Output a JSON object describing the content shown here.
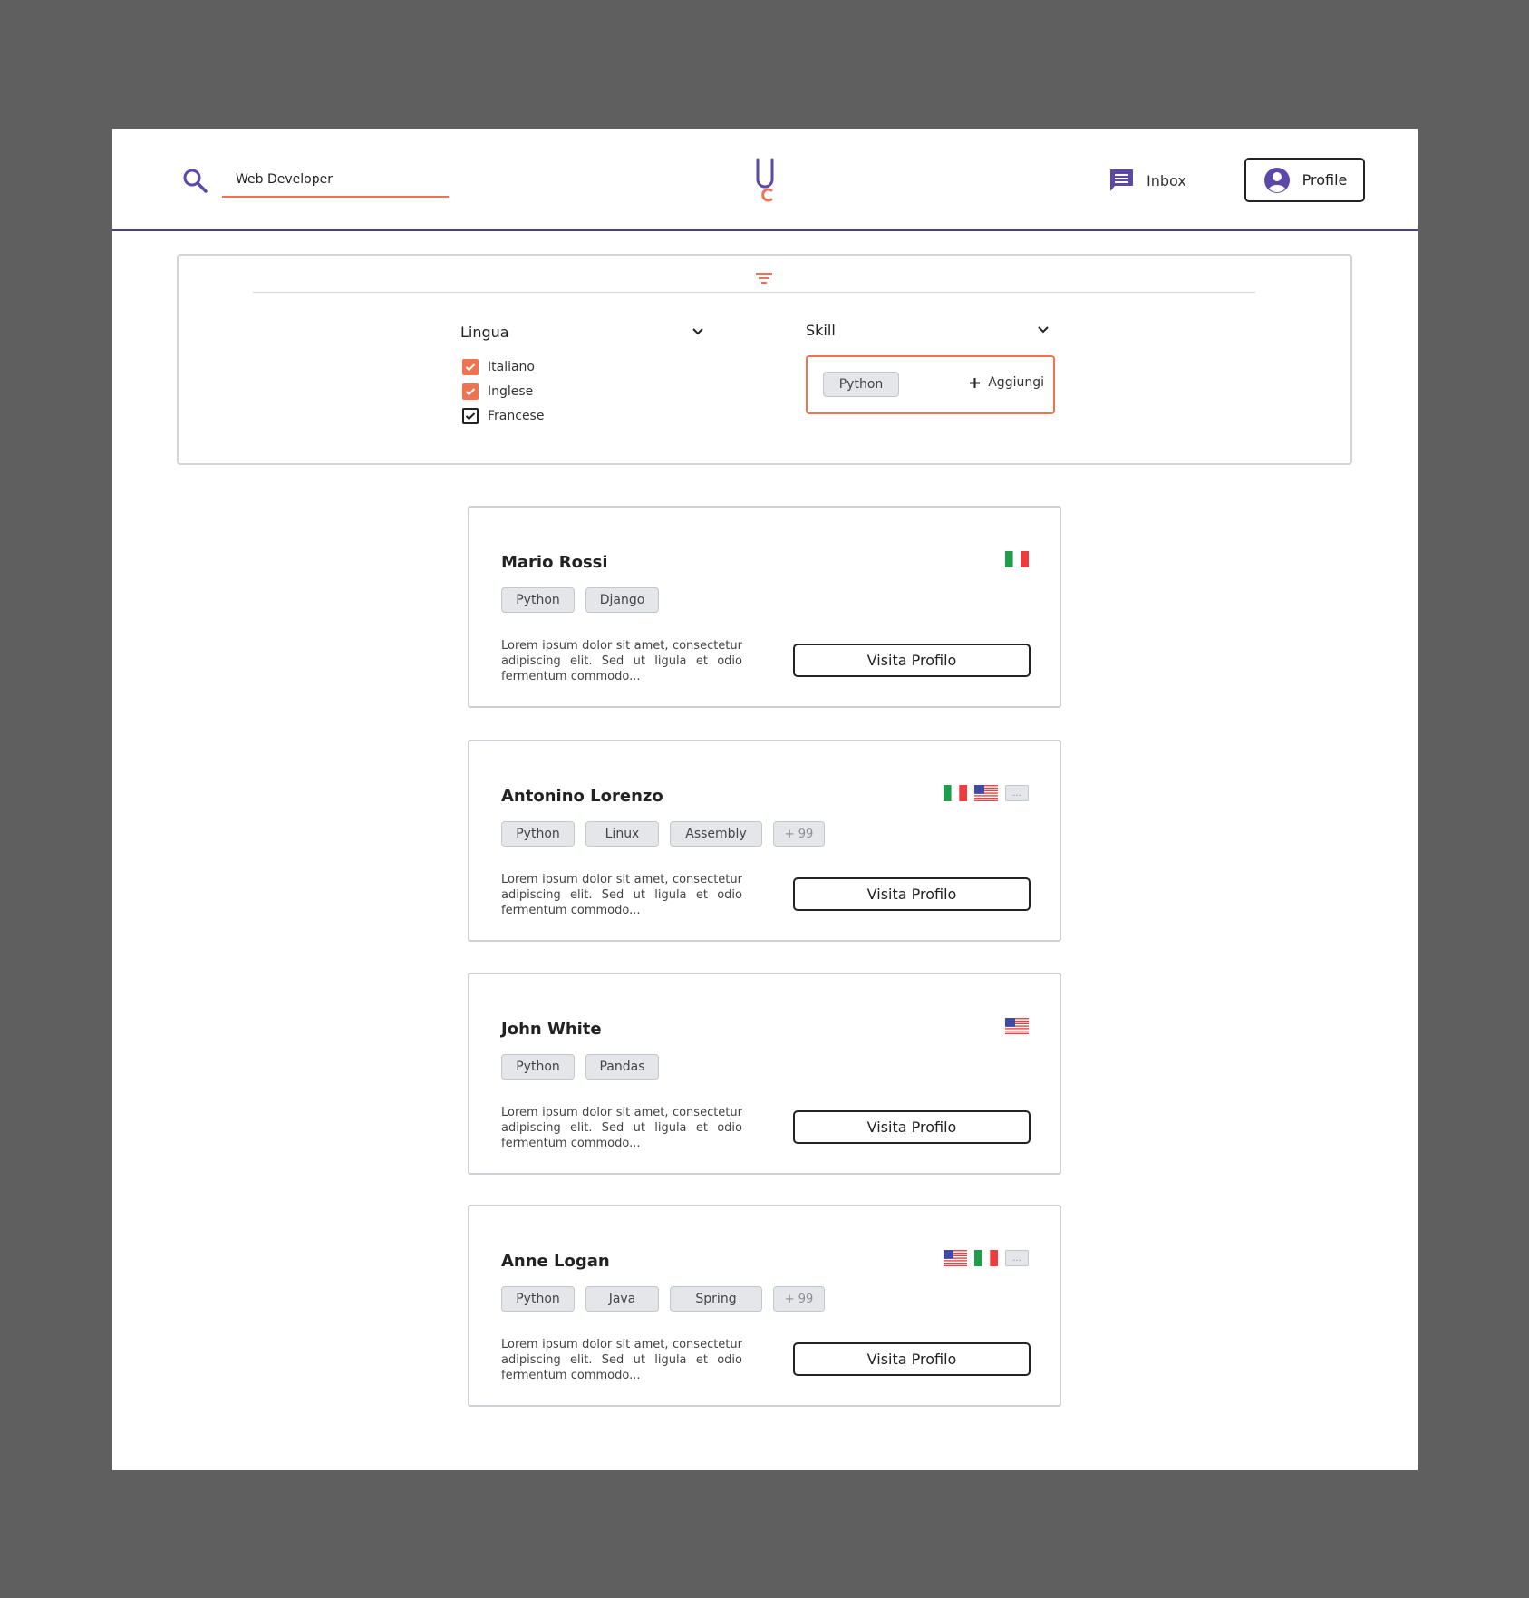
{
  "header": {
    "search_value": "Web Developer",
    "inbox_label": "Inbox",
    "profile_label": "Profile"
  },
  "filters": {
    "lingua": {
      "label": "Lingua",
      "options": [
        {
          "label": "Italiano",
          "checked": true
        },
        {
          "label": "Inglese",
          "checked": true
        },
        {
          "label": "Francese",
          "checked": true
        }
      ]
    },
    "skill": {
      "label": "Skill",
      "selected": [
        "Python"
      ],
      "add_label": "Aggiungi"
    }
  },
  "results": [
    {
      "name": "Mario Rossi",
      "flags": [
        "it-flag"
      ],
      "flags_more": "",
      "tags": [
        "Python",
        "Django"
      ],
      "description": "Lorem ipsum dolor sit amet, consectetur adipiscing elit. Sed ut ligula et odio fermentum commodo...",
      "button": "Visita Profilo"
    },
    {
      "name": "Antonino Lorenzo",
      "flags": [
        "it-flag",
        "us-flag"
      ],
      "flags_more": "...",
      "tags": [
        "Python",
        "Linux",
        "Assembly"
      ],
      "tags_more": "+ 99",
      "description": "Lorem ipsum dolor sit amet, consectetur adipiscing elit. Sed ut ligula et odio fermentum commodo...",
      "button": "Visita Profilo"
    },
    {
      "name": "John White",
      "flags": [
        "us-flag"
      ],
      "flags_more": "",
      "tags": [
        "Python",
        "Pandas"
      ],
      "description": "Lorem ipsum dolor sit amet, consectetur adipiscing elit. Sed ut ligula et odio fermentum commodo...",
      "button": "Visita Profilo"
    },
    {
      "name": "Anne Logan",
      "flags": [
        "us-flag",
        "it-flag"
      ],
      "flags_more": "...",
      "tags": [
        "Python",
        "Java",
        "Spring"
      ],
      "tags_more": "+ 99",
      "description": "Lorem ipsum dolor sit amet, consectetur adipiscing elit. Sed ut ligula et odio fermentum commodo...",
      "button": "Visita Profilo"
    }
  ],
  "colors": {
    "accent": "#f07351",
    "brand": "#5b48a8",
    "header_border": "#4c3f8a"
  },
  "icons": {
    "search": "search-icon",
    "logo": "logo-icon",
    "inbox": "chat-icon",
    "profile": "user-circle-icon",
    "filter": "filter-icon",
    "dropdown": "chevron-down-icon",
    "add": "plus-icon"
  }
}
